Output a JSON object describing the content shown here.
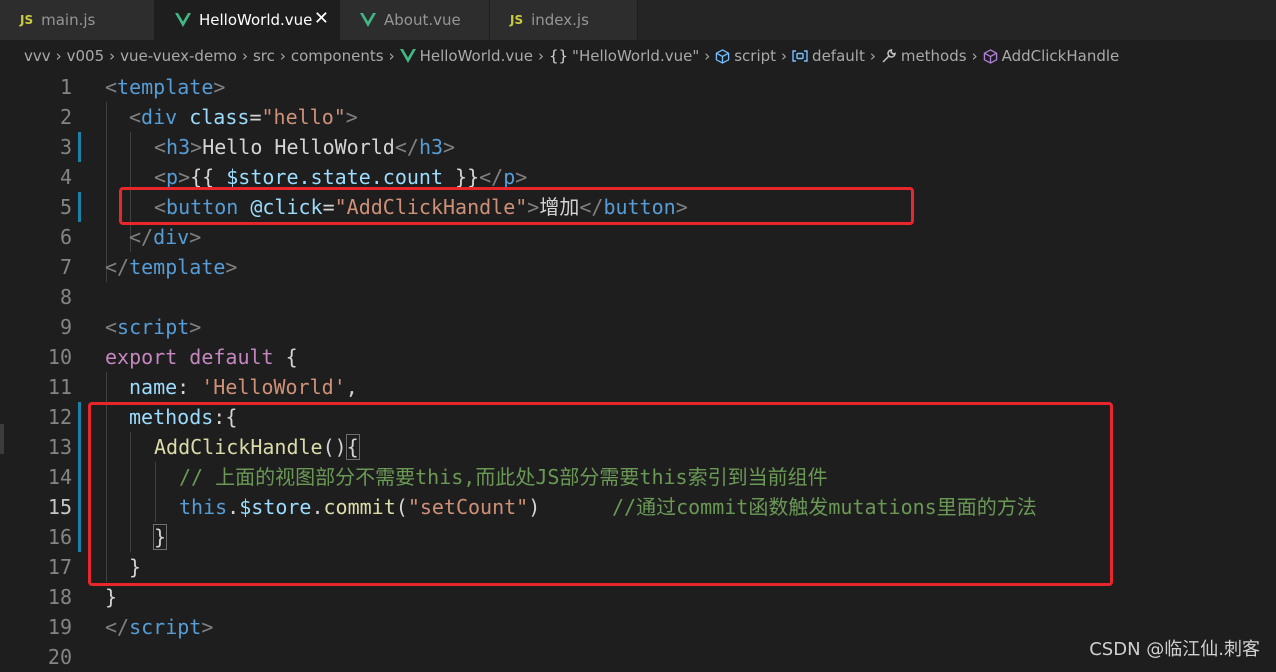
{
  "tabs": [
    {
      "label": "main.js",
      "icon": "js-icon",
      "badge": "JS"
    },
    {
      "label": "HelloWorld.vue",
      "icon": "vue-icon",
      "active": true,
      "close": "✕"
    },
    {
      "label": "About.vue",
      "icon": "vue-icon"
    },
    {
      "label": "index.js",
      "icon": "js-icon",
      "badge": "JS"
    }
  ],
  "breadcrumb": {
    "items": [
      "vvv",
      "v005",
      "vue-vuex-demo",
      "src",
      "components",
      "HelloWorld.vue",
      "\"HelloWorld.vue\"",
      "script",
      "default",
      "methods",
      "AddClickHandle"
    ],
    "braces": "{}",
    "separator": "›"
  },
  "editor": {
    "line_numbers": [
      "1",
      "2",
      "3",
      "4",
      "5",
      "6",
      "7",
      "8",
      "9",
      "10",
      "11",
      "12",
      "13",
      "14",
      "15",
      "16",
      "17",
      "18",
      "19",
      "20"
    ],
    "current_line": "15"
  },
  "code": {
    "l1": {
      "lt": "<",
      "tag": "template",
      "gt": ">"
    },
    "l2": {
      "lt": "<",
      "tag": "div",
      "attr": "class",
      "eq": "=",
      "val": "\"hello\"",
      "gt": ">"
    },
    "l3": {
      "lt": "<",
      "tag": "h3",
      "gt": ">",
      "text": "Hello HelloWorld",
      "lt2": "</",
      "tag2": "h3",
      "gt2": ">"
    },
    "l4": {
      "lt": "<",
      "tag": "p",
      "gt": ">",
      "open": "{{ ",
      "expr": "$store.state.count",
      "close": " }}",
      "lt2": "</",
      "tag2": "p",
      "gt2": ">"
    },
    "l5": {
      "lt": "<",
      "tag": "button",
      "attr": "@click",
      "eq": "=",
      "val": "\"AddClickHandle\"",
      "gt": ">",
      "text": "增加",
      "lt2": "</",
      "tag2": "button",
      "gt2": ">"
    },
    "l6": {
      "lt": "</",
      "tag": "div",
      "gt": ">"
    },
    "l7": {
      "lt": "</",
      "tag": "template",
      "gt": ">"
    },
    "l9": {
      "lt": "<",
      "tag": "script",
      "gt": ">"
    },
    "l10": {
      "kw1": "export",
      "kw2": "default",
      "brace": "{"
    },
    "l11": {
      "key": "name",
      "colon": ": ",
      "val": "'HelloWorld'",
      "comma": ","
    },
    "l12": {
      "key": "methods",
      "colon": ":",
      "brace": "{"
    },
    "l13": {
      "fn": "AddClickHandle",
      "paren": "()",
      "brace": "{"
    },
    "l14": {
      "comment": "// 上面的视图部分不需要this,而此处JS部分需要this索引到当前组件"
    },
    "l15": {
      "this": "this",
      "dot": ".",
      "var": "$store",
      "dot2": ".",
      "fn": "commit",
      "open": "(",
      "str": "\"setCount\"",
      "close": ")",
      "comment": "//通过commit函数触发mutations里面的方法"
    },
    "l16": {
      "brace": "}"
    },
    "l17": {
      "brace": "}"
    },
    "l18": {
      "brace": "}"
    },
    "l19": {
      "lt": "</",
      "tag": "script",
      "gt": ">"
    }
  },
  "watermark": "CSDN @临江仙.刺客",
  "colors": {
    "highlight_box": "#e8262b",
    "tag": "#569cd6",
    "string": "#ce9178",
    "comment": "#6a9955",
    "keyword": "#c586c0"
  }
}
